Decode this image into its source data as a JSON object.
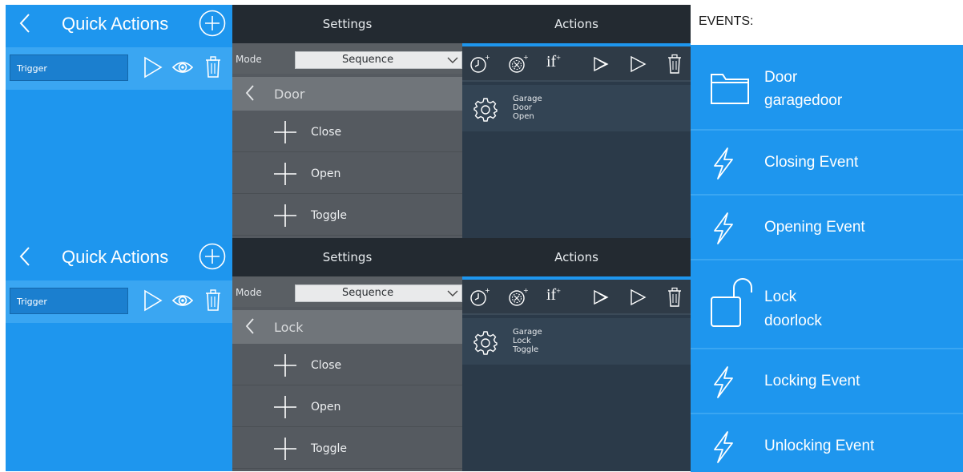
{
  "panels": [
    {
      "quick_actions": {
        "title": "Quick Actions",
        "trigger_label": "Trigger"
      },
      "settings": {
        "title": "Settings",
        "mode_label": "Mode",
        "mode_value": "Sequence",
        "category": "Door",
        "commands": [
          "Close",
          "Open",
          "Toggle"
        ]
      },
      "actions": {
        "title": "Actions",
        "if_label": "if",
        "if_sup": "+",
        "item_lines": [
          "Garage",
          "Door",
          "Open"
        ]
      }
    },
    {
      "quick_actions": {
        "title": "Quick Actions",
        "trigger_label": "Trigger"
      },
      "settings": {
        "title": "Settings",
        "mode_label": "Mode",
        "mode_value": "Sequence",
        "category": "Lock",
        "commands": [
          "Close",
          "Open",
          "Toggle"
        ]
      },
      "actions": {
        "title": "Actions",
        "if_label": "if",
        "if_sup": "+",
        "item_lines": [
          "Garage",
          "Lock",
          "Toggle"
        ]
      }
    }
  ],
  "events": {
    "label": "EVENTS:",
    "items": [
      {
        "icon": "folder-icon",
        "title": "Door",
        "subtitle": "garagedoor"
      },
      {
        "icon": "lightning-icon",
        "title": "Closing Event"
      },
      {
        "icon": "lightning-icon",
        "title": "Opening Event"
      },
      {
        "icon": "padlock-open-icon",
        "title": "Lock",
        "subtitle": "doorlock"
      },
      {
        "icon": "lightning-icon",
        "title": "Locking Event"
      },
      {
        "icon": "lightning-icon",
        "title": "Unlocking Event"
      }
    ]
  },
  "colors": {
    "accent": "#1e96ee",
    "dark_header": "#232a31",
    "settings_bg": "#555a60",
    "actions_bg": "#2b3a49"
  }
}
